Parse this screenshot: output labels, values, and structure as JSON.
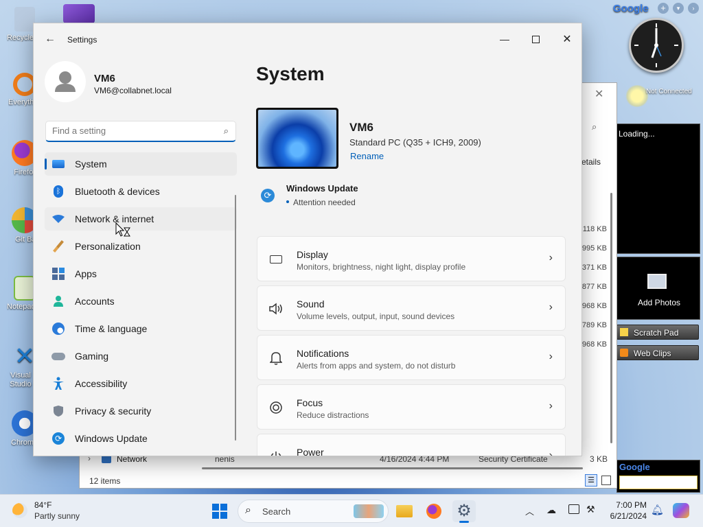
{
  "desktop": {
    "icons": [
      {
        "label": "Recycle Bin",
        "color": "#9fb6cf"
      },
      {
        "label": "Everything",
        "color": "#f07d1a"
      },
      {
        "label": "Firefox",
        "color": "#e8562d"
      },
      {
        "label": "Git Bash",
        "color": "#3a8fd8"
      },
      {
        "label": "Notepad++",
        "color": "#7cbd42"
      },
      {
        "label": "Visual Studio Code",
        "color": "#1e7fd6"
      },
      {
        "label": "Chrome",
        "color": "#2c73d6"
      }
    ],
    "gadgets": {
      "google_logo": "Google",
      "status": "Not Connected",
      "loading": "Loading...",
      "add_photos": "Add Photos",
      "scratch_pad": "Scratch Pad",
      "web_clips": "Web Clips",
      "google_search": "Google"
    }
  },
  "explorer": {
    "details": "etails",
    "sizes": [
      "118 KB",
      "995 KB",
      "371 KB",
      "877 KB",
      "968 KB",
      "789 KB",
      "968 KB"
    ],
    "row_name": "Network",
    "row_file": "nenis",
    "row_date": "4/16/2024 4:44 PM",
    "row_type": "Security Certificate",
    "row_size": "3 KB",
    "item_count": "12 items"
  },
  "settings": {
    "title": "Settings",
    "user": {
      "name": "VM6",
      "email": "VM6@collabnet.local"
    },
    "search_placeholder": "Find a setting",
    "nav": [
      {
        "label": "System",
        "icon": "monitor-icon",
        "active": true
      },
      {
        "label": "Bluetooth & devices",
        "icon": "bluetooth-icon"
      },
      {
        "label": "Network & internet",
        "icon": "wifi-icon"
      },
      {
        "label": "Personalization",
        "icon": "paintbrush-icon"
      },
      {
        "label": "Apps",
        "icon": "apps-icon"
      },
      {
        "label": "Accounts",
        "icon": "person-icon"
      },
      {
        "label": "Time & language",
        "icon": "globe-clock-icon"
      },
      {
        "label": "Gaming",
        "icon": "gamepad-icon"
      },
      {
        "label": "Accessibility",
        "icon": "accessibility-icon"
      },
      {
        "label": "Privacy & security",
        "icon": "shield-icon"
      },
      {
        "label": "Windows Update",
        "icon": "update-icon"
      }
    ],
    "page_title": "System",
    "device": {
      "name": "VM6",
      "model": "Standard PC (Q35 + ICH9, 2009)",
      "rename": "Rename"
    },
    "update": {
      "title": "Windows Update",
      "status": "Attention needed"
    },
    "cards": [
      {
        "title": "Display",
        "sub": "Monitors, brightness, night light, display profile",
        "icon": "display-icon"
      },
      {
        "title": "Sound",
        "sub": "Volume levels, output, input, sound devices",
        "icon": "speaker-icon"
      },
      {
        "title": "Notifications",
        "sub": "Alerts from apps and system, do not disturb",
        "icon": "bell-icon"
      },
      {
        "title": "Focus",
        "sub": "Reduce distractions",
        "icon": "focus-icon"
      },
      {
        "title": "Power",
        "sub": "",
        "icon": "power-icon"
      }
    ]
  },
  "taskbar": {
    "weather_temp": "84°F",
    "weather_desc": "Partly sunny",
    "search_label": "Search",
    "time": "7:00 PM",
    "date": "6/21/2024"
  }
}
